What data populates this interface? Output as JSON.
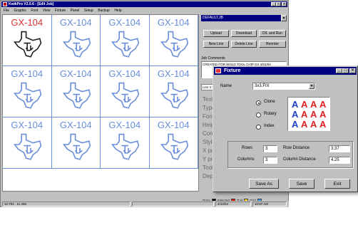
{
  "app": {
    "title": "KwikPro V2.0.6 - [Edit Job]",
    "controls": [
      "_",
      "□",
      "×"
    ],
    "menu": [
      "File",
      "Graphic",
      "Font",
      "View",
      "Fixture",
      "Panel",
      "Setup",
      "Backup",
      "Help"
    ]
  },
  "grid": {
    "cell_text": "GX-104",
    "cells": [
      {
        "selected": true
      },
      {
        "selected": false
      },
      {
        "selected": false
      },
      {
        "selected": false
      },
      {
        "selected": false
      },
      {
        "selected": false
      },
      {
        "selected": false
      },
      {
        "selected": false
      },
      {
        "selected": false
      },
      {
        "selected": false
      },
      {
        "selected": false
      },
      {
        "selected": false
      }
    ]
  },
  "panel": {
    "combo_value": "DEFAULT.JB",
    "combo_arrow": "▼",
    "buttons": [
      "Upload",
      "Download",
      "D/L and Run",
      "New Line",
      "Delete Line",
      "Reorder"
    ],
    "comments_label": "Job Comments",
    "comments": "CREATED FOR WOLD TOOL CHIP GX 4/01/04",
    "line_tab": "Line 2: GX-104",
    "properties": [
      "Text",
      "Type",
      "Font",
      "Height",
      "Compres",
      "Style",
      "X pos",
      "Y pos",
      "Tool #",
      "Depth"
    ],
    "legend": {
      "draw": "Draw",
      "selected": "Selected",
      "tool": "Tool",
      "grid": "Grid"
    },
    "legend_colors": {
      "draw": "#000000",
      "selected": "#ff0000",
      "tool": "#ffd700",
      "grid": "#3399ff"
    }
  },
  "status": {
    "coords": "12.702 , 11.466",
    "date": "4/12/04",
    "time": "10:57 AM"
  },
  "dialog": {
    "title": "Fixture",
    "controls": [
      "_",
      "□",
      "×"
    ],
    "name_label": "Name",
    "name_value": "3x3.FIX",
    "modes": [
      {
        "label": "Clone",
        "selected": true
      },
      {
        "label": "Rotary",
        "selected": false
      },
      {
        "label": "Index",
        "selected": false
      }
    ],
    "preview_letter": "A",
    "preview_colors": {
      "selected": "#1e3cc8",
      "other": "#e02020"
    },
    "rows_label": "Rows",
    "rows_value": "3",
    "columns_label": "Columns",
    "columns_value": "3",
    "row_distance_label": "Row Distance",
    "row_distance_value": "3.37",
    "column_distance_label": "Column Distance",
    "column_distance_value": "4.25",
    "buttons": [
      "Save As",
      "Save",
      "Exit"
    ]
  }
}
